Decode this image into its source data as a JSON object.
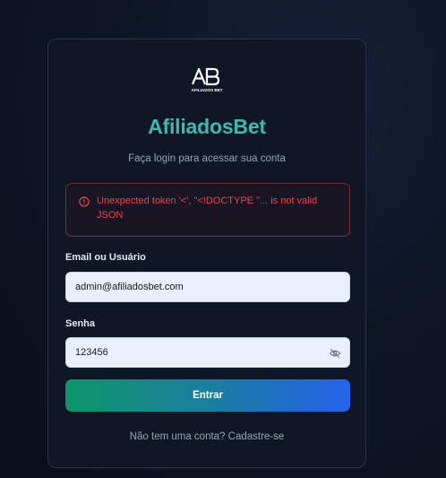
{
  "brand": {
    "logo_text": "AB",
    "logo_subtext": "AFILIADOS BET",
    "name": "AfiliadosBet",
    "subtitle": "Faça login para acessar sua conta"
  },
  "error": {
    "message": "Unexpected token '<', \"<!DOCTYPE \"... is not valid JSON",
    "icon": "alert-circle-icon"
  },
  "form": {
    "email_label": "Email ou Usuário",
    "email_value": "admin@afiliadosbet.com",
    "password_label": "Senha",
    "password_value": "123456",
    "toggle_icon": "eye-off-icon",
    "submit_label": "Entrar"
  },
  "footer": {
    "signup_text": "Não tem uma conta? Cadastre-se"
  },
  "colors": {
    "brand": "#3fb8b0",
    "error": "#e5484d",
    "button_start": "#0d9569",
    "button_end": "#2563eb"
  }
}
